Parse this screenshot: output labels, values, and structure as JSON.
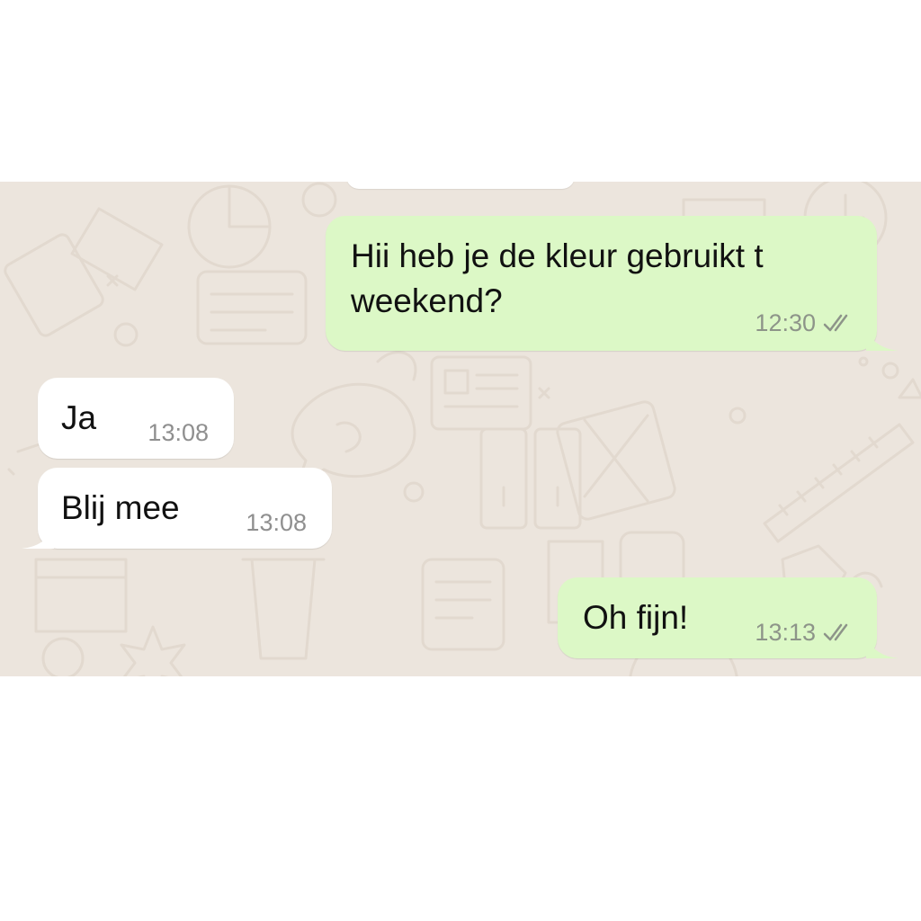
{
  "chat": {
    "colors": {
      "wallpaper": "#ece5dd",
      "outgoing_bubble": "#dcf8c6",
      "incoming_bubble": "#ffffff",
      "timestamp": "#8d9489"
    },
    "messages": [
      {
        "direction": "outgoing",
        "lines": [
          "Hii heb je de kleur gebruikt t",
          "weekend?"
        ],
        "time": "12:30",
        "status_icon": "double-check-icon"
      },
      {
        "direction": "incoming",
        "text": "Ja",
        "time": "13:08"
      },
      {
        "direction": "incoming",
        "text": "Blij mee",
        "time": "13:08"
      },
      {
        "direction": "outgoing",
        "text": "Oh fijn!",
        "time": "13:13",
        "status_icon": "double-check-icon"
      }
    ]
  }
}
